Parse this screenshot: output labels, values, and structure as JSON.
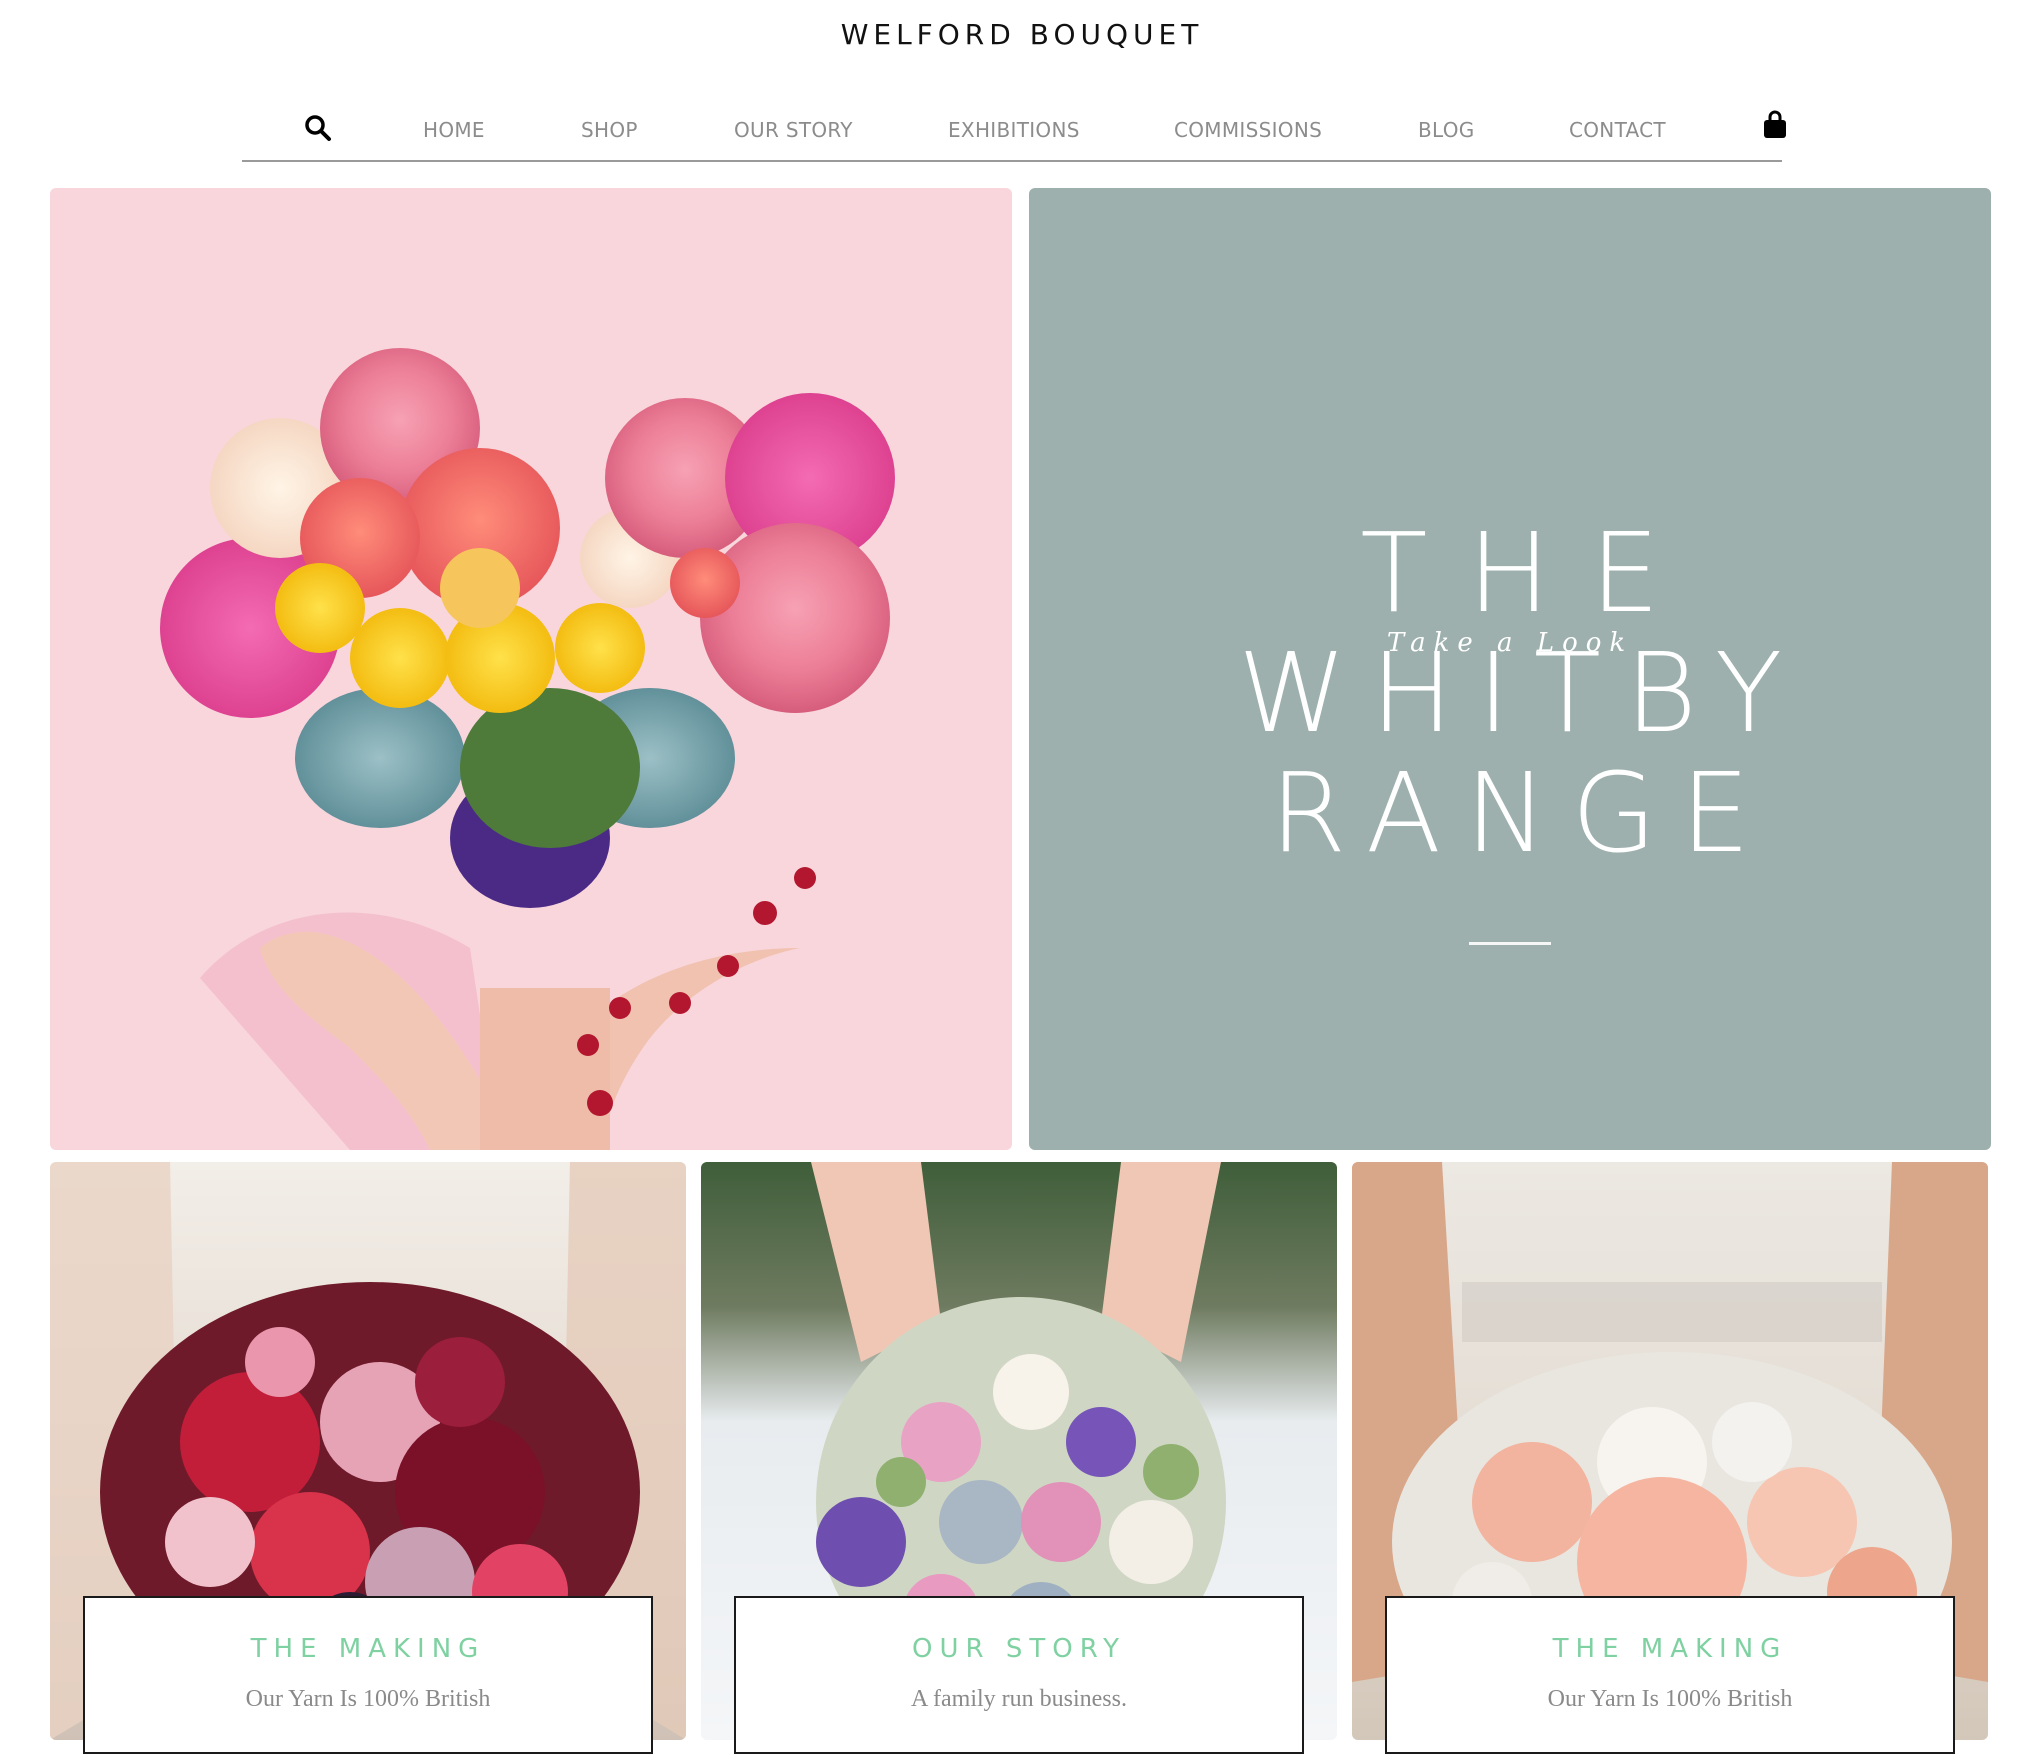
{
  "site": {
    "title": "WELFORD BOUQUET"
  },
  "nav": {
    "search_icon": "search-icon",
    "items": [
      "HOME",
      "SHOP",
      "OUR STORY",
      "EXHIBITIONS",
      "COMMISSIONS",
      "BLOG",
      "CONTACT"
    ],
    "cart_icon": "shopping-bag-icon"
  },
  "feature": {
    "kicker": "Take a Look",
    "title_lines": [
      "THE",
      "WHITBY",
      "RANGE"
    ]
  },
  "cards": [
    {
      "title": "THE MAKING",
      "subtitle": "Our Yarn Is 100% British"
    },
    {
      "title": "OUR STORY",
      "subtitle": "A family run business."
    },
    {
      "title": "THE MAKING",
      "subtitle": "Our Yarn Is 100% British"
    }
  ],
  "colors": {
    "hero_pink": "#f8d6dc",
    "feature_sage": "#9db0ad",
    "caption_green": "#7fd1a2",
    "nav_text": "#8c8c8c"
  }
}
